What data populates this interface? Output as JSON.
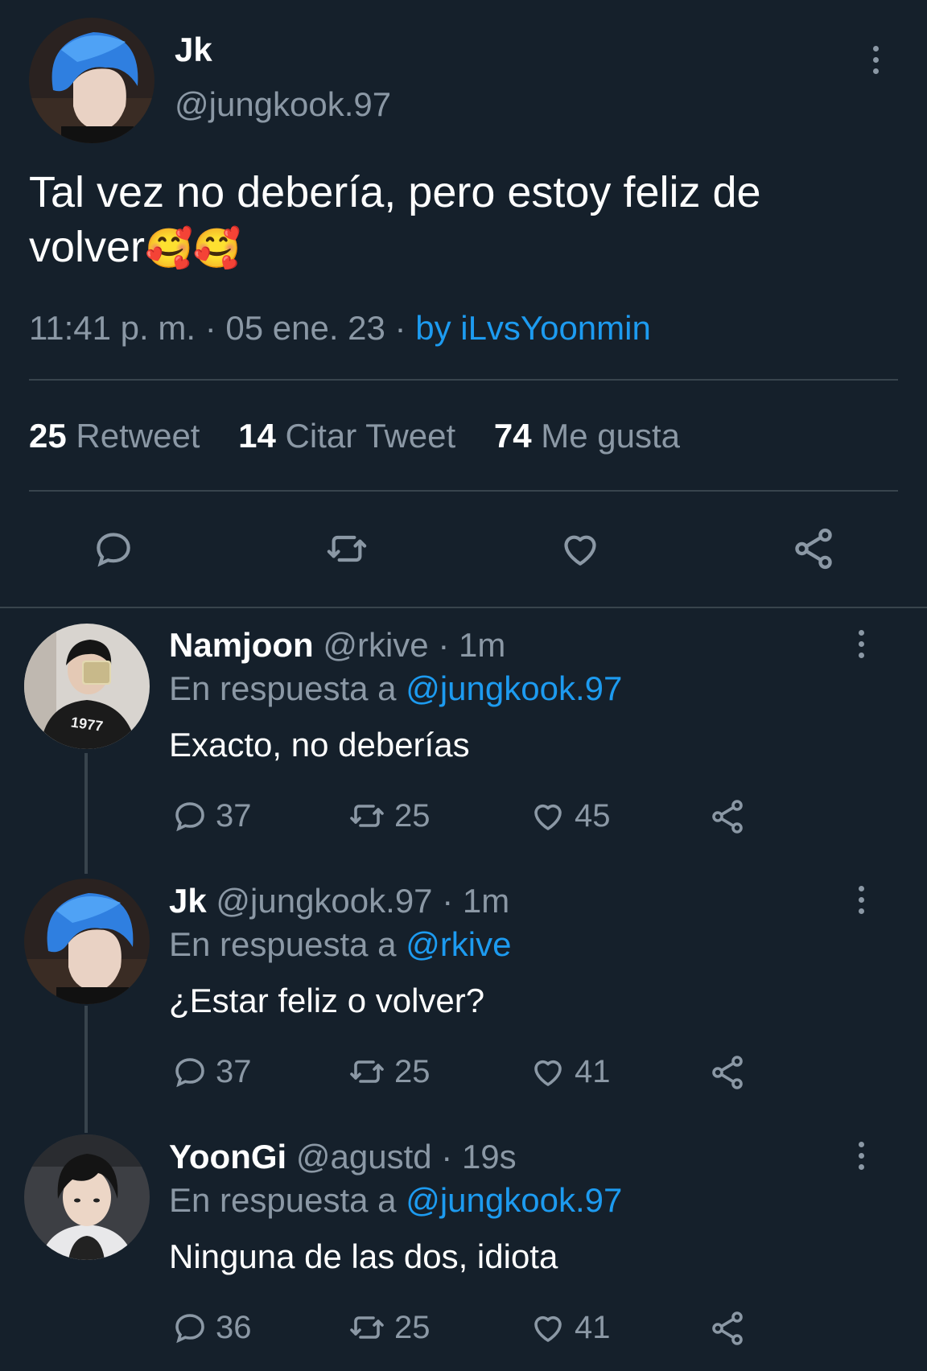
{
  "main_tweet": {
    "name": "Jk",
    "handle": "@jungkook.97",
    "text_line1": "Tal vez no debería, pero estoy feliz de",
    "text_line2": "volver",
    "emojis": "🥰🥰",
    "time": "11:41 p. m.",
    "date": "05 ene. 23",
    "source": "by iLvsYoonmin",
    "sep": "·",
    "retweets_count": "25",
    "retweets_label": "Retweet",
    "quotes_count": "14",
    "quotes_label": "Citar Tweet",
    "likes_count": "74",
    "likes_label": "Me gusta"
  },
  "replies": [
    {
      "name": "Namjoon",
      "handle": "@rkive",
      "time": "· 1m",
      "reply_prefix": "En respuesta a",
      "reply_to": "@jungkook.97",
      "text": "Exacto, no deberías",
      "replies": "37",
      "retweets": "25",
      "likes": "45",
      "avatar_text": "1977"
    },
    {
      "name": "Jk",
      "handle": "@jungkook.97",
      "time": "· 1m",
      "reply_prefix": "En respuesta a",
      "reply_to": "@rkive",
      "text": "¿Estar feliz o volver?",
      "replies": "37",
      "retweets": "25",
      "likes": "41"
    },
    {
      "name": "YoonGi",
      "handle": "@agustd",
      "time": "· 19s",
      "reply_prefix": "En respuesta a",
      "reply_to": "@jungkook.97",
      "text": "Ninguna de las dos, idiota",
      "replies": "36",
      "retweets": "25",
      "likes": "41"
    }
  ],
  "icons": {
    "reply": "speech-bubble-icon",
    "retweet": "retweet-arrows-icon",
    "like": "heart-outline-icon",
    "share": "share-nodes-icon",
    "more": "vertical-dots-icon"
  },
  "colors": {
    "background": "#15202b",
    "muted": "#8b98a5",
    "link": "#1d9bf0",
    "divider": "#38444d"
  }
}
